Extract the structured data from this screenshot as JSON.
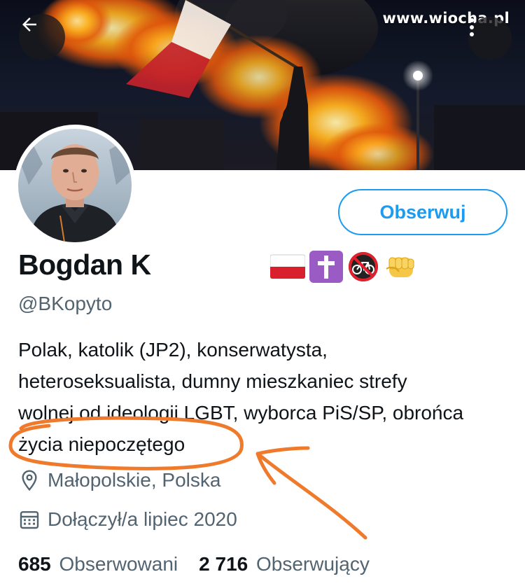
{
  "watermark": "www.wiocha.pl",
  "profile": {
    "name": "Bogdan K",
    "handle": "@BKopyto",
    "follow_label": "Obserwuj",
    "bio_lines": [
      "Polak, katolik (JP2), konserwatysta,",
      "heteroseksualista, dumny mieszkaniec strefy",
      "wolnej od ideologii LGBT, wyborca PiS/SP, obrońca",
      "życia niepoczętego"
    ],
    "location": "Małopolskie, Polska",
    "joined": "Dołączył/a lipiec 2020",
    "following_count": "685",
    "following_label": "Obserwowani",
    "followers_count": "2 716",
    "followers_label": "Obserwujący",
    "emoji_icons": [
      "poland-flag-icon",
      "latin-cross-icon",
      "no-bicycles-icon",
      "fist-icon"
    ]
  },
  "colors": {
    "accent": "#1d9bf0",
    "text_primary": "#0f1419",
    "text_secondary": "#536471",
    "annotation": "#f07a2c"
  },
  "icons": {
    "back": "arrow-left-icon",
    "more": "more-vertical-icon",
    "location": "location-pin-icon",
    "calendar": "calendar-icon"
  }
}
